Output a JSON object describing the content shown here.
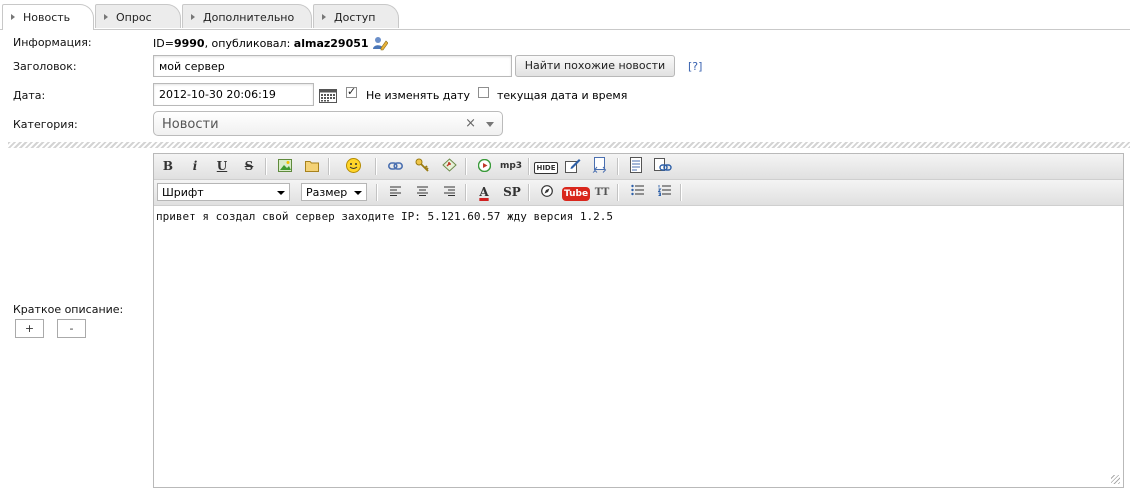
{
  "tabs": [
    {
      "label": "Новость"
    },
    {
      "label": "Опрос"
    },
    {
      "label": "Дополнительно"
    },
    {
      "label": "Доступ"
    }
  ],
  "info": {
    "label": "Информация:",
    "id_prefix": "ID=",
    "id_value": "9990",
    "published_by": ", опубликовал:",
    "author": "almaz29051"
  },
  "title_field": {
    "label": "Заголовок:",
    "value": "мой сервер",
    "find_similar_button": "Найти похожие новости",
    "help": "[?]"
  },
  "date_field": {
    "label": "Дата:",
    "value": "2012-10-30 20:06:19",
    "keep_date_label": "Не изменять дату",
    "keep_date_checked": true,
    "current_date_label": "текущая дата и время",
    "current_date_checked": false
  },
  "category": {
    "label": "Категория:",
    "value": "Новости",
    "clear": "×"
  },
  "short_desc": {
    "label": "Краткое описание:",
    "plus": "+",
    "minus": "-",
    "text": "привет я создал свой сервер заходите IP: 5.121.60.57 жду версия 1.2.5"
  },
  "toolbar": {
    "font_select": "Шрифт",
    "size_select": "Размер",
    "bold": "B",
    "italic": "i",
    "underline": "U",
    "strike": "S",
    "mp3": "mp3",
    "hide": "HIDE",
    "sp": "SP",
    "tt": "TT",
    "youtube": "Tube",
    "color_a": "A"
  }
}
